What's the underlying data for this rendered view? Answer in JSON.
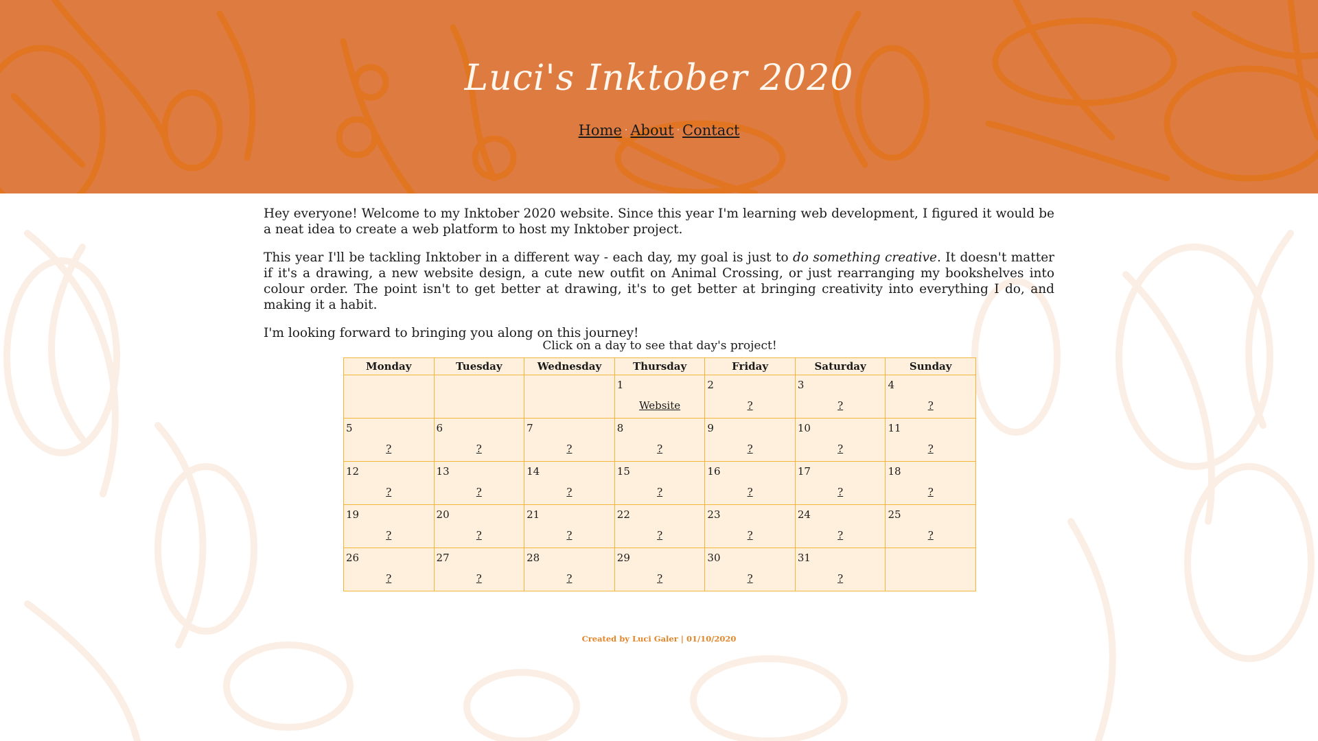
{
  "header": {
    "title": "Luci's Inktober 2020",
    "background_color": "#dd7b40",
    "nav": [
      {
        "label": "Home"
      },
      {
        "label": "About"
      },
      {
        "label": "Contact"
      }
    ],
    "nav_separator": "·"
  },
  "intro": {
    "p1": "Hey everyone! Welcome to my Inktober 2020 website. Since this year I'm learning web development, I figured it would be a neat idea to create a web platform to host my Inktober project.",
    "p2_before": "This year I'll be tackling Inktober in a different way - each day, my goal is just to ",
    "p2_emphasis": "do something creative",
    "p2_after": ". It doesn't matter if it's a drawing, a new website design, a cute new outfit on Animal Crossing, or just rearranging my bookshelves into colour order. The point isn't to get better at drawing, it's to get better at bringing creativity into everything I do, and making it a habit.",
    "p3": "I'm looking forward to bringing you along on this journey!"
  },
  "calendar": {
    "caption": "Click on a day to see that day's project!",
    "days_of_week": [
      "Monday",
      "Tuesday",
      "Wednesday",
      "Thursday",
      "Friday",
      "Saturday",
      "Sunday"
    ],
    "weeks": [
      [
        null,
        null,
        null,
        {
          "day": "1",
          "link": "Website"
        },
        {
          "day": "2",
          "link": "?"
        },
        {
          "day": "3",
          "link": "?"
        },
        {
          "day": "4",
          "link": "?"
        }
      ],
      [
        {
          "day": "5",
          "link": "?"
        },
        {
          "day": "6",
          "link": "?"
        },
        {
          "day": "7",
          "link": "?"
        },
        {
          "day": "8",
          "link": "?"
        },
        {
          "day": "9",
          "link": "?"
        },
        {
          "day": "10",
          "link": "?"
        },
        {
          "day": "11",
          "link": "?"
        }
      ],
      [
        {
          "day": "12",
          "link": "?"
        },
        {
          "day": "13",
          "link": "?"
        },
        {
          "day": "14",
          "link": "?"
        },
        {
          "day": "15",
          "link": "?"
        },
        {
          "day": "16",
          "link": "?"
        },
        {
          "day": "17",
          "link": "?"
        },
        {
          "day": "18",
          "link": "?"
        }
      ],
      [
        {
          "day": "19",
          "link": "?"
        },
        {
          "day": "20",
          "link": "?"
        },
        {
          "day": "21",
          "link": "?"
        },
        {
          "day": "22",
          "link": "?"
        },
        {
          "day": "23",
          "link": "?"
        },
        {
          "day": "24",
          "link": "?"
        },
        {
          "day": "25",
          "link": "?"
        }
      ],
      [
        {
          "day": "26",
          "link": "?"
        },
        {
          "day": "27",
          "link": "?"
        },
        {
          "day": "28",
          "link": "?"
        },
        {
          "day": "29",
          "link": "?"
        },
        {
          "day": "30",
          "link": "?"
        },
        {
          "day": "31",
          "link": "?"
        },
        null
      ]
    ],
    "cell_color": "#fff0dd",
    "border_color": "#f1b53a"
  },
  "footer": {
    "text": "Created by Luci Galer | 01/10/2020",
    "color": "#e3862a"
  }
}
